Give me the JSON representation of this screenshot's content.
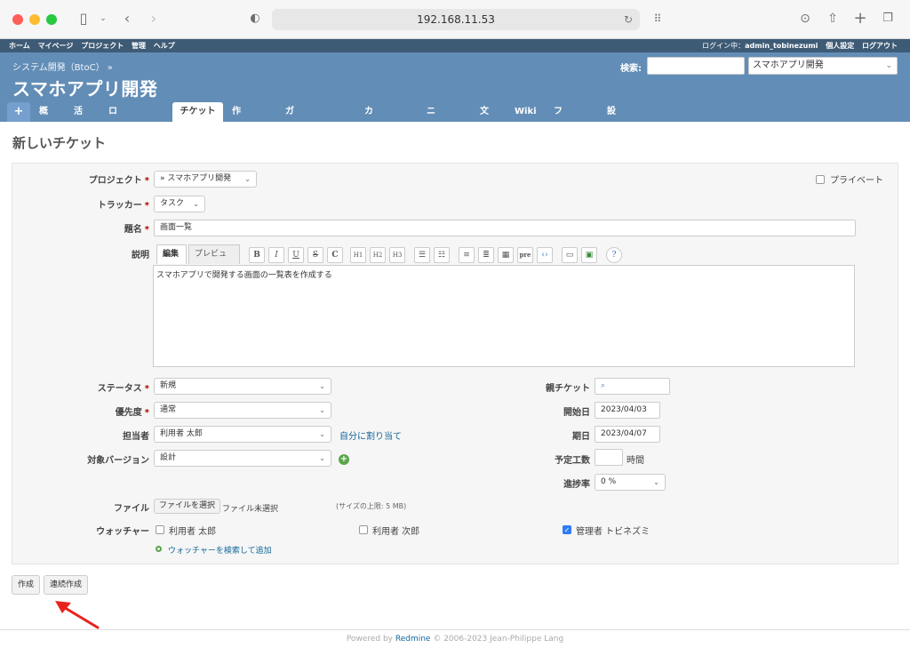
{
  "browser": {
    "url": "192.168.11.53"
  },
  "topmenu": {
    "items": [
      "ホーム",
      "マイページ",
      "プロジェクト",
      "管理",
      "ヘルプ"
    ],
    "login_label": "ログイン中：",
    "user": "admin_tobinezumi",
    "my_account": "個人設定",
    "logout": "ログアウト"
  },
  "header": {
    "parent": "システム開発（BtoC） »",
    "title": "スマホアプリ開発",
    "search_label": "検索:",
    "project_select": "スマホアプリ開発"
  },
  "tabs": {
    "plus": "+",
    "items": [
      "概要",
      "活動",
      "ロードマップ",
      "チケット",
      "作業時間",
      "ガントチャート",
      "カレンダー",
      "ニュース",
      "文書",
      "Wiki",
      "ファイル",
      "設定"
    ],
    "selected": "チケット"
  },
  "page": {
    "title": "新しいチケット"
  },
  "form": {
    "project_label": "プロジェクト",
    "project_value": "» スマホアプリ開発",
    "private_label": "プライベート",
    "tracker_label": "トラッカー",
    "tracker_value": "タスク",
    "subject_label": "題名",
    "subject_value": "画面一覧",
    "description_label": "説明",
    "editor_tab_edit": "編集",
    "editor_tab_preview": "プレビュー",
    "description_value": "スマホアプリで開発する画面の一覧表を作成する",
    "status_label": "ステータス",
    "status_value": "新規",
    "priority_label": "優先度",
    "priority_value": "通常",
    "assignee_label": "担当者",
    "assignee_value": "利用者 太郎",
    "assign_to_me": "自分に割り当て",
    "version_label": "対象バージョン",
    "version_value": "設計",
    "parent_label": "親チケット",
    "start_label": "開始日",
    "start_value": "2023/04/03",
    "due_label": "期日",
    "due_value": "2023/04/07",
    "estimate_label": "予定工数",
    "estimate_unit": "時間",
    "done_label": "進捗率",
    "done_value": "0 %",
    "file_label": "ファイル",
    "file_button": "ファイルを選択",
    "file_none": "ファイル未選択",
    "file_limit": "(サイズの上限: 5 MB)",
    "watchers_label": "ウォッチャー",
    "watchers": [
      {
        "name": "利用者 太郎",
        "checked": false
      },
      {
        "name": "利用者 次郎",
        "checked": false
      },
      {
        "name": "管理者 トビネズミ",
        "checked": true
      }
    ],
    "watcher_search": "ウォッチャーを検索して追加"
  },
  "buttons": {
    "create": "作成",
    "create_continue": "連続作成"
  },
  "footer": {
    "prefix": "Powered by ",
    "link": "Redmine",
    "suffix": " © 2006-2023 Jean-Philippe Lang"
  },
  "colors": {
    "header": "#628db6",
    "topmenu": "#3e5b76",
    "required": "#bb0000",
    "link": "#116699",
    "arrow": "#e8231d"
  }
}
